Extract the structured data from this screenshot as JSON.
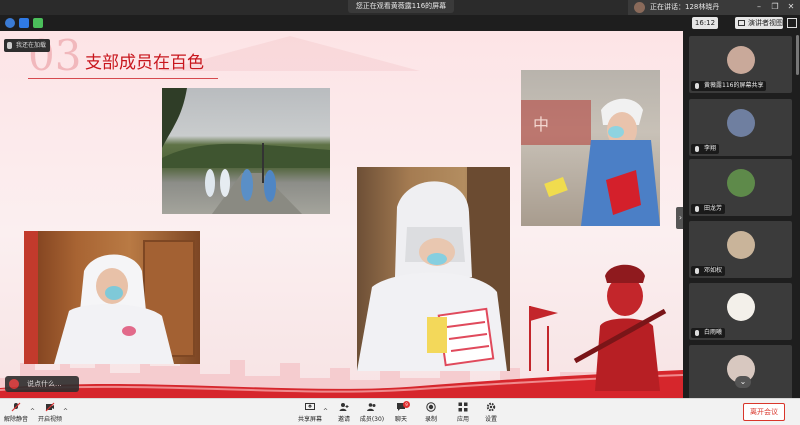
{
  "top_bar": {
    "share_banner": "您正在观看黄薇露116的屏幕",
    "speaking_label": "正在讲话：128林晓丹",
    "window_controls": [
      "minimize-icon",
      "restore-icon",
      "close-icon"
    ]
  },
  "view_bar": {
    "timer": "16:12",
    "speaker_view_label": "演讲者视图",
    "security_badges": [
      "info-icon",
      "shield-icon",
      "signal-icon"
    ]
  },
  "slide": {
    "number": "03",
    "title": "支部成员在百色",
    "tag_label": "我还在加载",
    "chat_placeholder": "说点什么...",
    "accent_color": "#c8161d"
  },
  "panel": {
    "participants": [
      {
        "name": "黄薇露116的屏幕共享",
        "face_color": "#c9a99a",
        "kind": "screen-share"
      },
      {
        "name": "李翔",
        "face_color": "#6f7fa0",
        "kind": "camera"
      },
      {
        "name": "田龙芳",
        "face_color": "#5e8a4a",
        "kind": "avatar"
      },
      {
        "name": "邓如权",
        "face_color": "#c9b49a",
        "kind": "avatar"
      },
      {
        "name": "白雨曦",
        "face_color": "#f3f0ea",
        "kind": "avatar"
      },
      {
        "name": "",
        "face_color": "#d8c8c0",
        "kind": "avatar"
      }
    ]
  },
  "toolbar": {
    "mute": "解除静音",
    "video": "开启视频",
    "share": "共享屏幕",
    "invite": "邀请",
    "members": "成员(30)",
    "chat": "聊天",
    "record": "录制",
    "apps": "应用",
    "settings": "设置",
    "leave": "离开会议",
    "chat_unread": "9"
  }
}
